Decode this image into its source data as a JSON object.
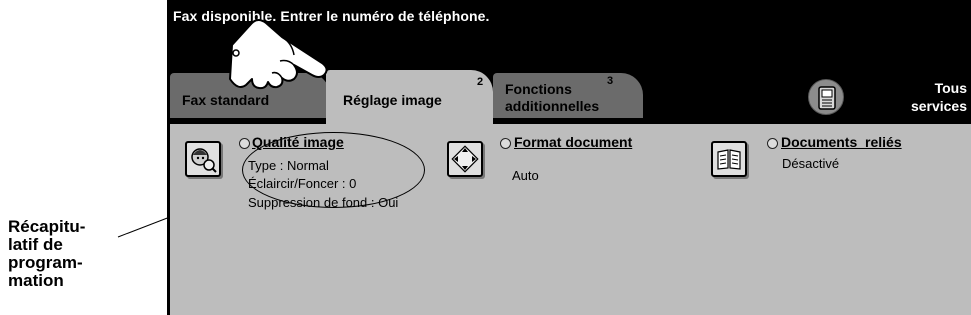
{
  "callout": {
    "text_lines": [
      "Récapitu-",
      "latif de",
      "program-",
      "mation"
    ]
  },
  "status_message": "Fax disponible. Entrer le numéro de téléphone.",
  "tabs": [
    {
      "label": "Fax standard",
      "number": ""
    },
    {
      "label": "Réglage image",
      "number": "2"
    },
    {
      "label_lines": [
        "Fonctions",
        "additionnelles"
      ],
      "number": "3"
    }
  ],
  "all_services": {
    "label_lines": [
      "Tous",
      "services"
    ],
    "icon": "services-icon"
  },
  "features": {
    "image_quality": {
      "title": "Qualité image",
      "lines": [
        "Type : Normal",
        "Éclaircir/Foncer : 0",
        "Suppression de fond : Oui"
      ]
    },
    "document_format": {
      "title": "Format document",
      "value": "Auto"
    },
    "bound_documents": {
      "title": "Documents  reliés",
      "value": "Désactivé"
    }
  },
  "colors": {
    "panel_bg": "#000000",
    "active_tab": "#bdbdbd",
    "inactive_tab": "#6b6b6b",
    "content_bg": "#bdbdbd"
  }
}
